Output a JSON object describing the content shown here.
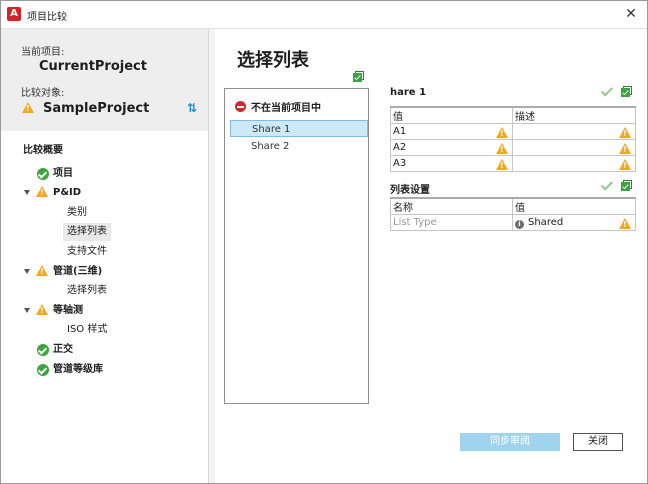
{
  "window": {
    "title": "项目比较",
    "app_icon_letter": "A",
    "close_glyph": "✕"
  },
  "left": {
    "current_label": "当前项目:",
    "current_value": "CurrentProject",
    "compare_label": "比较对象:",
    "compare_value": "SampleProject",
    "swap_glyph": "⇅",
    "summary_title": "比较概要",
    "tree": [
      {
        "label": "项目",
        "status": "ok"
      },
      {
        "label": "P&ID",
        "status": "warning"
      },
      {
        "label": "类别"
      },
      {
        "label": "选择列表",
        "selected": true
      },
      {
        "label": "支持文件"
      },
      {
        "label": "管道(三维)",
        "status": "warning"
      },
      {
        "label": "选择列表"
      },
      {
        "label": "等轴测",
        "status": "warning"
      },
      {
        "label": "ISO 样式"
      },
      {
        "label": "正交",
        "status": "ok"
      },
      {
        "label": "管道等级库",
        "status": "ok"
      }
    ]
  },
  "main": {
    "title": "选择列表",
    "list": {
      "header": "不在当前项目中",
      "items": [
        "Share 1",
        "Share 2"
      ],
      "selected": "Share 1"
    },
    "share_section": {
      "title": "hare 1",
      "columns": [
        "值",
        "描述"
      ],
      "rows": [
        [
          "A1",
          ""
        ],
        [
          "A2",
          ""
        ],
        [
          "A3",
          ""
        ]
      ]
    },
    "settings_section": {
      "title": "列表设置",
      "columns": [
        "名称",
        "值"
      ],
      "rows": [
        [
          "List Type",
          "Shared"
        ]
      ],
      "info_glyph": "i"
    }
  },
  "buttons": {
    "sync": "同步审阅",
    "close": "关闭"
  },
  "colors": {
    "accent": "#1d8fd6",
    "warning": "#f5a623",
    "ok": "#3aa53a",
    "error": "#d12828",
    "selected": "#cde8f7"
  }
}
